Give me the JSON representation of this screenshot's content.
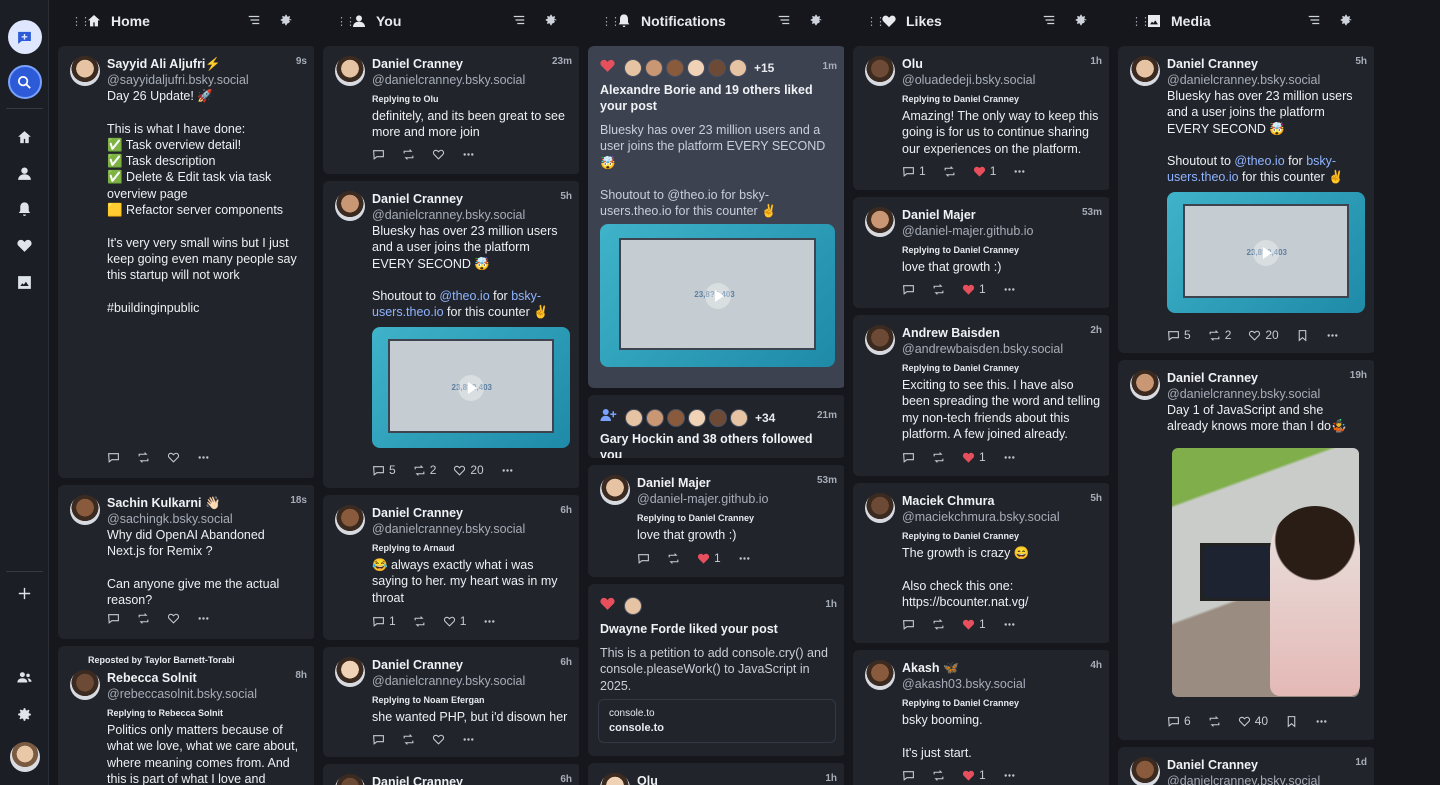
{
  "sidebar": {
    "items": [
      "compose",
      "search",
      "home",
      "you",
      "notifications",
      "likes",
      "media",
      "add",
      "people",
      "settings",
      "profile"
    ]
  },
  "columns": [
    {
      "title": "Home",
      "icon": "home-icon"
    },
    {
      "title": "You",
      "icon": "person-icon"
    },
    {
      "title": "Notifications",
      "icon": "bell-icon"
    },
    {
      "title": "Likes",
      "icon": "heart-icon"
    },
    {
      "title": "Media",
      "icon": "image-icon"
    }
  ],
  "home": [
    {
      "name": "Sayyid Ali Aljufri⚡",
      "handle": "@sayyidaljufri.bsky.social",
      "time": "9s",
      "text": "Day 26 Update! 🚀\n\nThis is what I have done:\n✅ Task overview detail!\n✅ Task description\n✅ Delete & Edit task via task overview page\n🟨 Refactor server components\n\nIt's very very small wins but I just keep going even many people say this startup will not work\n\n#buildinginpublic"
    },
    {
      "name": "Sachin Kulkarni 👋🏻",
      "handle": "@sachingk.bsky.social",
      "time": "18s",
      "text": "Why did OpenAI Abandoned Next.js for Remix ?\n\nCan anyone give me the actual reason?"
    },
    {
      "repost": "Reposted by Taylor Barnett-Torabi",
      "name": "Rebecca Solnit",
      "handle": "@rebeccasolnit.bsky.social",
      "time": "8h",
      "reply": "Replying to Rebecca Solnit",
      "text": "Politics only matters because of what we love, what we care about, where meaning comes from. And this is part of what I love and"
    }
  ],
  "you": [
    {
      "name": "Daniel Cranney",
      "handle": "@danielcranney.bsky.social",
      "time": "23m",
      "reply": "Replying to Olu",
      "text": "definitely, and its been great to see more and more join"
    },
    {
      "name": "Daniel Cranney",
      "handle": "@danielcranney.bsky.social",
      "time": "5h",
      "text": "Bluesky has over 23 million users and a user joins the platform EVERY SECOND 🤯\n\nShoutout to ",
      "link1": "@theo.io",
      "mid": " for ",
      "link2": "bsky-users.theo.io",
      "tail": " for this counter ✌️",
      "replies": "5",
      "reposts": "2",
      "likes": "20",
      "screen": "23,8?0,403"
    },
    {
      "name": "Daniel Cranney",
      "handle": "@danielcranney.bsky.social",
      "time": "6h",
      "reply": "Replying to Arnaud",
      "text": "😂 always exactly what i was saying to her. my heart was in my throat",
      "replies": "1",
      "likes": "1"
    },
    {
      "name": "Daniel Cranney",
      "handle": "@danielcranney.bsky.social",
      "time": "6h",
      "reply": "Replying to Noam Efergan",
      "text": "she wanted PHP, but i'd disown her"
    },
    {
      "name": "Daniel Cranney",
      "time": "6h"
    }
  ],
  "notifs": [
    {
      "extra": "+15",
      "time": "1m",
      "head": "Alexandre Borie and 19 others liked your post",
      "text": "Bluesky has over 23 million users and a user joins the platform EVERY SECOND 🤯\n\nShoutout to @theo.io for bsky-users.theo.io for this counter ✌️",
      "screen": "23,8?0,403"
    },
    {
      "extra": "+34",
      "time": "21m",
      "head": "Gary Hockin and 38 others followed you"
    },
    {
      "name": "Daniel Majer",
      "handle": "@daniel-majer.github.io",
      "time": "53m",
      "reply": "Replying to Daniel Cranney",
      "text": "love that growth :)",
      "likes": "1"
    },
    {
      "time": "1h",
      "head": "Dwayne Forde liked your post",
      "text": "This is a petition to add console.cry() and console.pleaseWork() to JavaScript in 2025.",
      "q1": "console.to",
      "q2": "console.to"
    },
    {
      "name": "Olu",
      "time": "1h"
    }
  ],
  "likes": [
    {
      "name": "Olu",
      "handle": "@oluadedeji.bsky.social",
      "time": "1h",
      "reply": "Replying to Daniel Cranney",
      "text": "Amazing! The only way to keep this going is for us to continue sharing our experiences on the platform.",
      "replies": "1",
      "likes": "1"
    },
    {
      "name": "Daniel Majer",
      "handle": "@daniel-majer.github.io",
      "time": "53m",
      "reply": "Replying to Daniel Cranney",
      "text": "love that growth :)",
      "likes": "1"
    },
    {
      "name": "Andrew Baisden",
      "handle": "@andrewbaisden.bsky.social",
      "time": "2h",
      "reply": "Replying to Daniel Cranney",
      "text": "Exciting to see this. I have also been spreading the word and telling my non-tech friends about this platform. A few joined already.",
      "likes": "1"
    },
    {
      "name": "Maciek Chmura",
      "handle": "@maciekchmura.bsky.social",
      "time": "5h",
      "reply": "Replying to Daniel Cranney",
      "text": "The growth is crazy 😄\n\nAlso check this one:\nhttps://bcounter.nat.vg/",
      "likes": "1"
    },
    {
      "name": "Akash 🦋",
      "handle": "@akash03.bsky.social",
      "time": "4h",
      "reply": "Replying to Daniel Cranney",
      "text": "bsky booming.\n\nIt's just start.",
      "likes": "1"
    }
  ],
  "media": [
    {
      "name": "Daniel Cranney",
      "handle": "@danielcranney.bsky.social",
      "time": "5h",
      "text": "Bluesky has over 23 million users and a user joins the platform EVERY SECOND 🤯\n\nShoutout to ",
      "link1": "@theo.io",
      "mid": " for ",
      "link2": "bsky-users.theo.io",
      "tail": " for this counter ✌️",
      "replies": "5",
      "reposts": "2",
      "likes": "20",
      "screen": "23,8?0,403"
    },
    {
      "name": "Daniel Cranney",
      "handle": "@danielcranney.bsky.social",
      "time": "19h",
      "text": "Day 1 of JavaScript and she already knows more than I do🤹",
      "replies": "6",
      "likes": "40"
    },
    {
      "name": "Daniel Cranney",
      "handle": "@danielcranney.bsky.social",
      "time": "1d"
    }
  ],
  "colors": {
    "accent": "#8fb4ff",
    "like": "#e84f5d",
    "bg": "#15171c",
    "card": "#21242b"
  }
}
